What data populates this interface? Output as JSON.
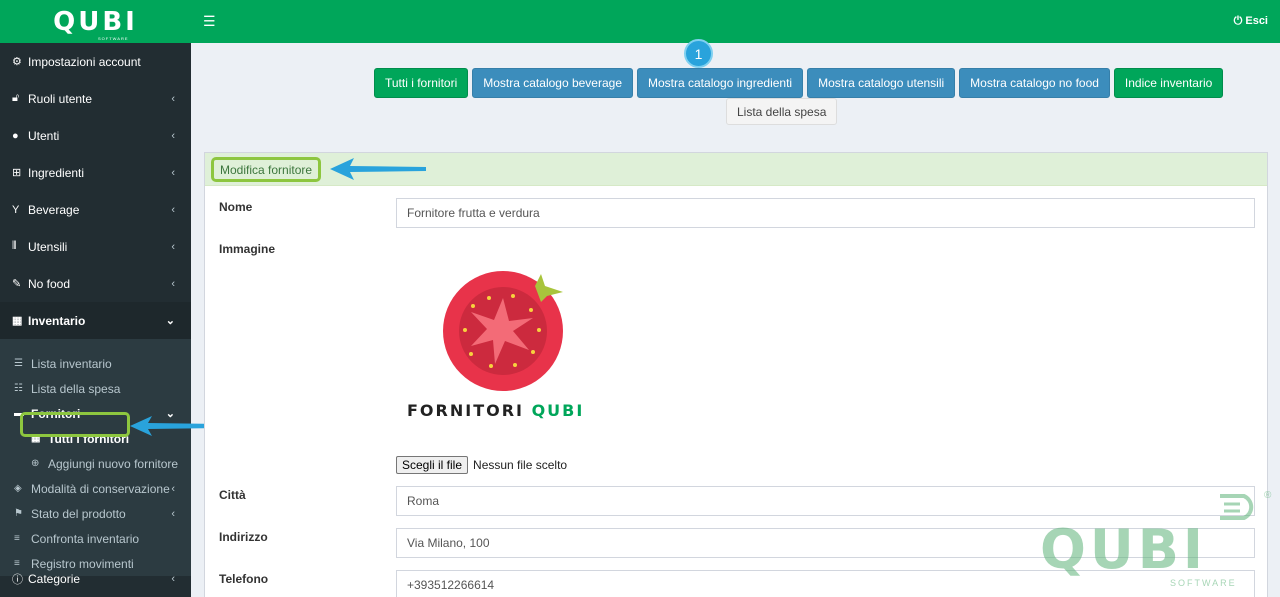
{
  "brand": {
    "logo": "QUBI",
    "logo_sub": "SOFTWARE"
  },
  "header": {
    "menu_icon": "hamburger-icon",
    "logout_label": "Esci"
  },
  "sidebar": {
    "items": [
      {
        "label": "Impostazioni account",
        "icon": "gear-icon"
      },
      {
        "label": "Ruoli utente",
        "icon": "unlock-icon"
      },
      {
        "label": "Utenti",
        "icon": "user-icon"
      },
      {
        "label": "Ingredienti",
        "icon": "sitemap-icon"
      },
      {
        "label": "Beverage",
        "icon": "filter-icon"
      },
      {
        "label": "Utensili",
        "icon": "cutlery-icon"
      },
      {
        "label": "No food",
        "icon": "wrench-icon"
      },
      {
        "label": "Inventario",
        "icon": "table-icon"
      }
    ],
    "inventario_sub": [
      {
        "label": "Lista inventario"
      },
      {
        "label": "Lista della spesa"
      },
      {
        "label": "Fornitori"
      },
      {
        "label": "Modalità di conservazione"
      },
      {
        "label": "Stato del prodotto"
      },
      {
        "label": "Confronta inventario"
      },
      {
        "label": "Registro movimenti"
      }
    ],
    "fornitori_sub": [
      {
        "label": "Tutti i fornitori"
      },
      {
        "label": "Aggiungi nuovo fornitore"
      }
    ],
    "bottom": {
      "label": "Categorie"
    }
  },
  "step_badge": "1",
  "toolbar": {
    "buttons": [
      {
        "label": "Tutti i fornitori",
        "color": "#00a65a"
      },
      {
        "label": "Mostra catalogo beverage",
        "color": "#3c8dbc"
      },
      {
        "label": "Mostra catalogo ingredienti",
        "color": "#3c8dbc"
      },
      {
        "label": "Mostra catalogo utensili",
        "color": "#3c8dbc"
      },
      {
        "label": "Mostra catalogo no food",
        "color": "#3c8dbc"
      },
      {
        "label": "Indice inventario",
        "color": "#00a65a"
      }
    ],
    "shopping_list": "Lista della spesa"
  },
  "panel": {
    "title": "Modifica fornitore",
    "fields": {
      "nome_label": "Nome",
      "nome_value": "Fornitore frutta e verdura",
      "immagine_label": "Immagine",
      "image_caption_a": "FORNITORI ",
      "image_caption_b": "QUBI",
      "file_button": "Scegli il file",
      "file_status": "Nessun file scelto",
      "citta_label": "Città",
      "citta_value": "Roma",
      "indirizzo_label": "Indirizzo",
      "indirizzo_value": "Via Milano, 100",
      "telefono_label": "Telefono",
      "telefono_value": "+393512266614"
    }
  },
  "watermark": {
    "text": "QUBI",
    "sub": "SOFTWARE",
    "reg": "®"
  },
  "colors": {
    "accent": "#00a65a",
    "blue": "#3c8dbc",
    "highlight": "#8dc63f",
    "arrow": "#29a3dc"
  }
}
